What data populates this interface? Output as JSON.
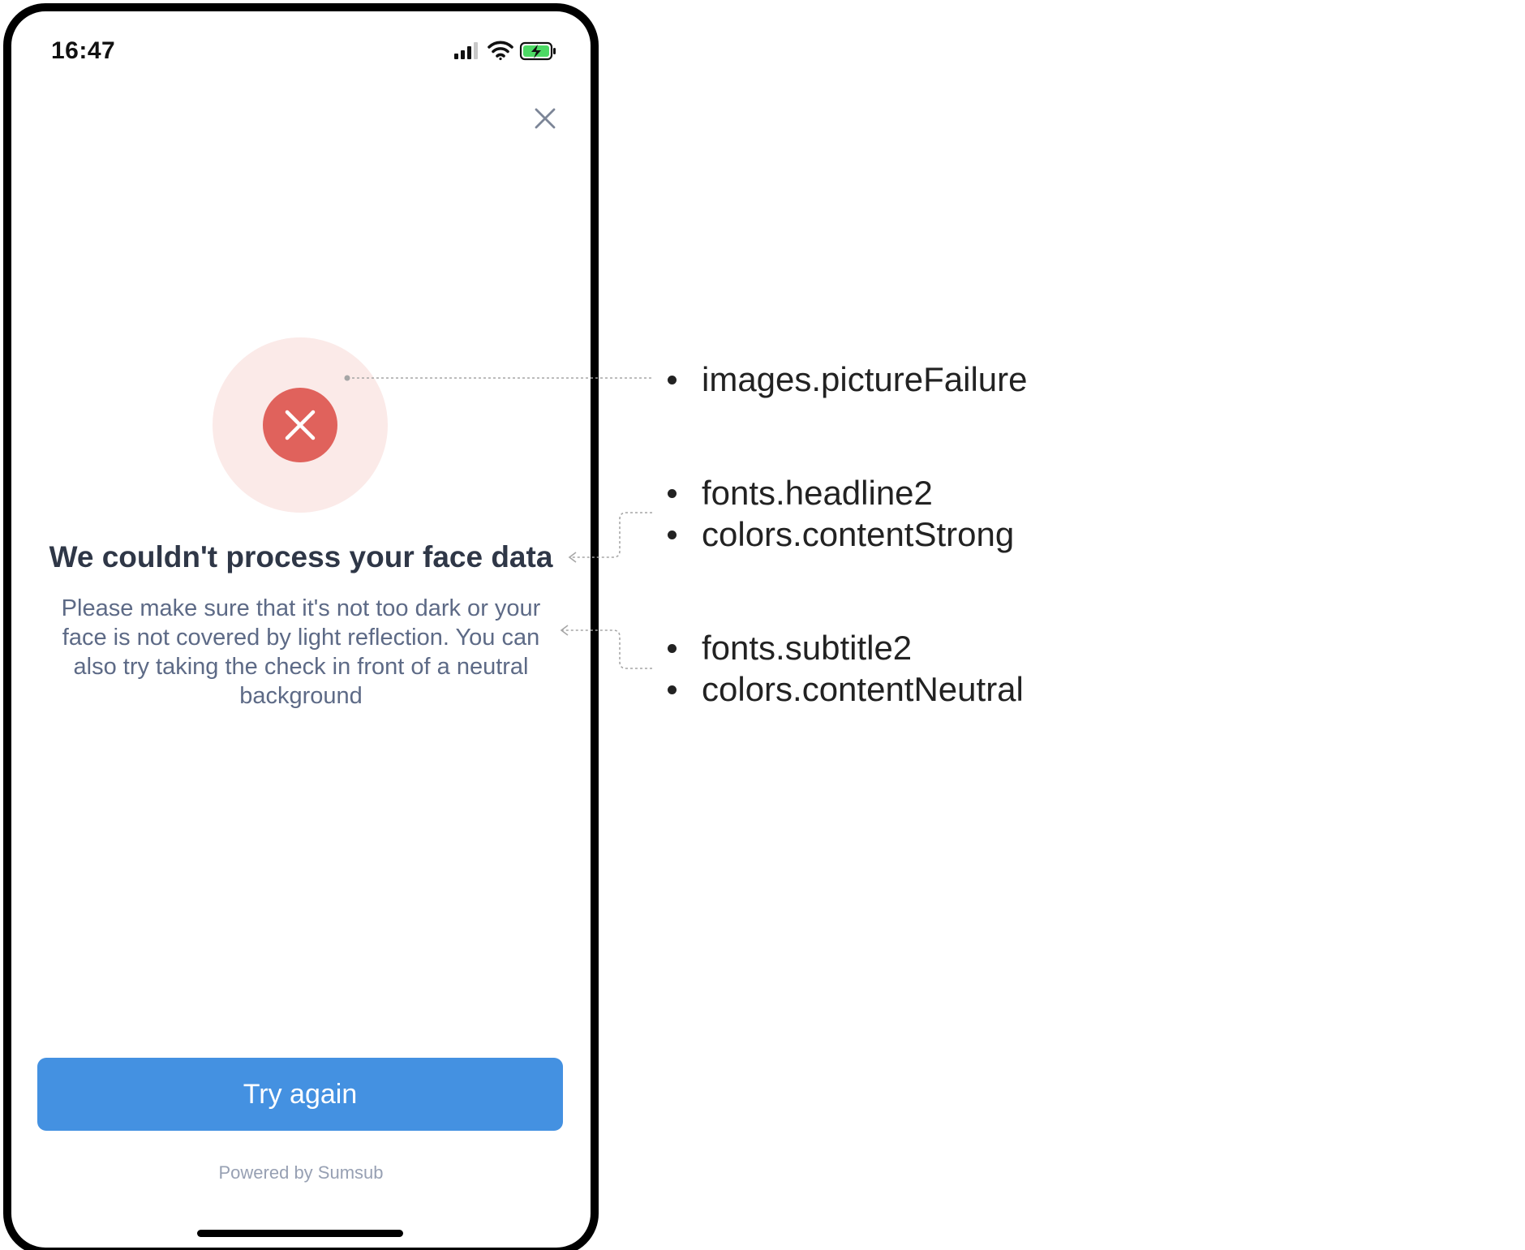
{
  "status_bar": {
    "time": "16:47",
    "icons": [
      "cellular-signal-icon",
      "wifi-icon",
      "battery-charging-icon"
    ],
    "battery_color": "#4cd964"
  },
  "header": {
    "close_icon": "close-icon"
  },
  "failure_picture": {
    "icon": "error-x-icon",
    "outer_color": "#fbeae8",
    "inner_color": "#e0625c"
  },
  "headline": "We couldn't process your face data",
  "subtitle": "Please make sure that it's not too dark or your face is not covered by light reflection. You can also try taking the check in front of a neutral background",
  "primary_button": {
    "label": "Try again",
    "color": "#4491e1"
  },
  "footer": {
    "powered_by": "Powered by Sumsub"
  },
  "annotations": [
    {
      "items": [
        "images.pictureFailure"
      ]
    },
    {
      "items": [
        "fonts.headline2",
        "colors.contentStrong"
      ]
    },
    {
      "items": [
        "fonts.subtitle2",
        "colors.contentNeutral"
      ]
    }
  ]
}
